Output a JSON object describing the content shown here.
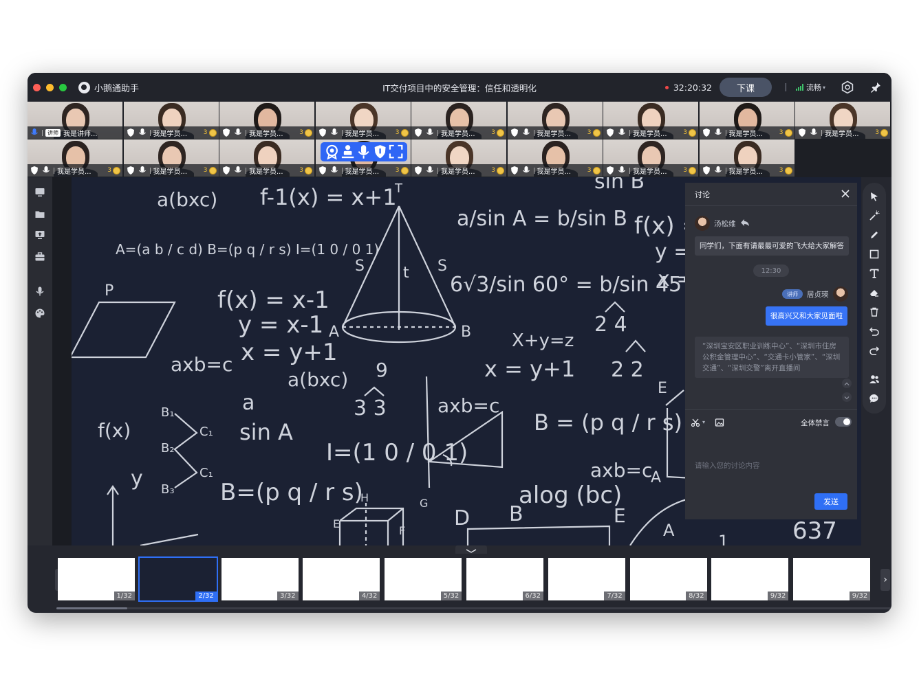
{
  "app": {
    "name": "小鹅通助手",
    "lesson_title": "IT交付项目中的安全管理：信任和透明化",
    "timer": "32:20:32",
    "end_class_label": "下课",
    "network_quality": "流畅",
    "colors": {
      "accent": "#2f6ff5",
      "rec_dot": "#f04848",
      "signal": "#3fc26b"
    }
  },
  "participants": [
    {
      "name": "我是讲师...",
      "teacher_tag": "讲师",
      "role": "teacher",
      "count": ""
    },
    {
      "name": "我是学员...",
      "count": "3"
    },
    {
      "name": "我是学员...",
      "count": "3"
    },
    {
      "name": "我是学员...",
      "count": "3"
    },
    {
      "name": "我是学员...",
      "count": "3"
    },
    {
      "name": "我是学员...",
      "count": "3"
    },
    {
      "name": "我是学员...",
      "count": "3"
    },
    {
      "name": "我是学员...",
      "count": "3"
    },
    {
      "name": "我是学员...",
      "count": "3"
    },
    {
      "name": "我是学员...",
      "count": "3"
    },
    {
      "name": "我是学员...",
      "count": "3"
    },
    {
      "name": "我是学员...",
      "count": "3"
    },
    {
      "name": "我是学员...",
      "count": "3"
    },
    {
      "name": "我是学员...",
      "count": "3"
    },
    {
      "name": "我是学员...",
      "count": "3"
    },
    {
      "name": "我是学员...",
      "count": "3"
    },
    {
      "name": "我是学员...",
      "count": "3"
    }
  ],
  "tile_hover_toolbar": [
    "award-icon",
    "stage-icon",
    "mic-icon",
    "shield-icon",
    "fullscreen-icon"
  ],
  "left_rail": [
    "courseware-icon",
    "folder-icon",
    "screen-share-icon",
    "toolbox-icon",
    "microphone-icon",
    "palette-icon"
  ],
  "whiteboard_tools": [
    "pointer-icon",
    "laser-icon",
    "pen-icon",
    "shape-icon",
    "text-icon",
    "eraser-icon",
    "trash-icon",
    "undo-icon",
    "redo-icon",
    "members-icon",
    "chat-icon"
  ],
  "board_formulas": [
    "a(bxc)",
    "f-1(x) = x+1",
    "a/sin A = b/sin B",
    "f(x) = x-1",
    "y = x-1",
    "x = y+1",
    "axb=c",
    "a(bxc)",
    "6√3/sin 60° = b/sin 45°",
    "X+y=z",
    "x = y+1",
    "f(x)",
    "a/sin A",
    "B = (p q / r s)",
    "alog (bc)",
    "axb=c",
    "637"
  ],
  "chat": {
    "title": "讨论",
    "messages": [
      {
        "sender": "汤松维",
        "text": "同学们，下面有请最最可爱的飞大给大家解答",
        "side": "left"
      },
      {
        "time": "12:30"
      },
      {
        "sender": "居贞瑛",
        "role_tag": "讲师",
        "text": "很高兴又和大家见面啦",
        "side": "right"
      },
      {
        "system": "“深圳宝安区职业训练中心”、“深圳市住房公积金管理中心”、“交通卡小管家”、“深圳交通”、“深圳交警”离开直播间"
      }
    ],
    "mute_all_label": "全体禁言",
    "mute_all": false,
    "input_placeholder": "请输入您的讨论内容",
    "send_label": "发送"
  },
  "slides": {
    "current": 2,
    "pages": [
      "1/32",
      "2/32",
      "3/32",
      "4/32",
      "5/32",
      "6/32",
      "7/32",
      "8/32",
      "9/32",
      "9/32"
    ],
    "progress": 0.085
  }
}
